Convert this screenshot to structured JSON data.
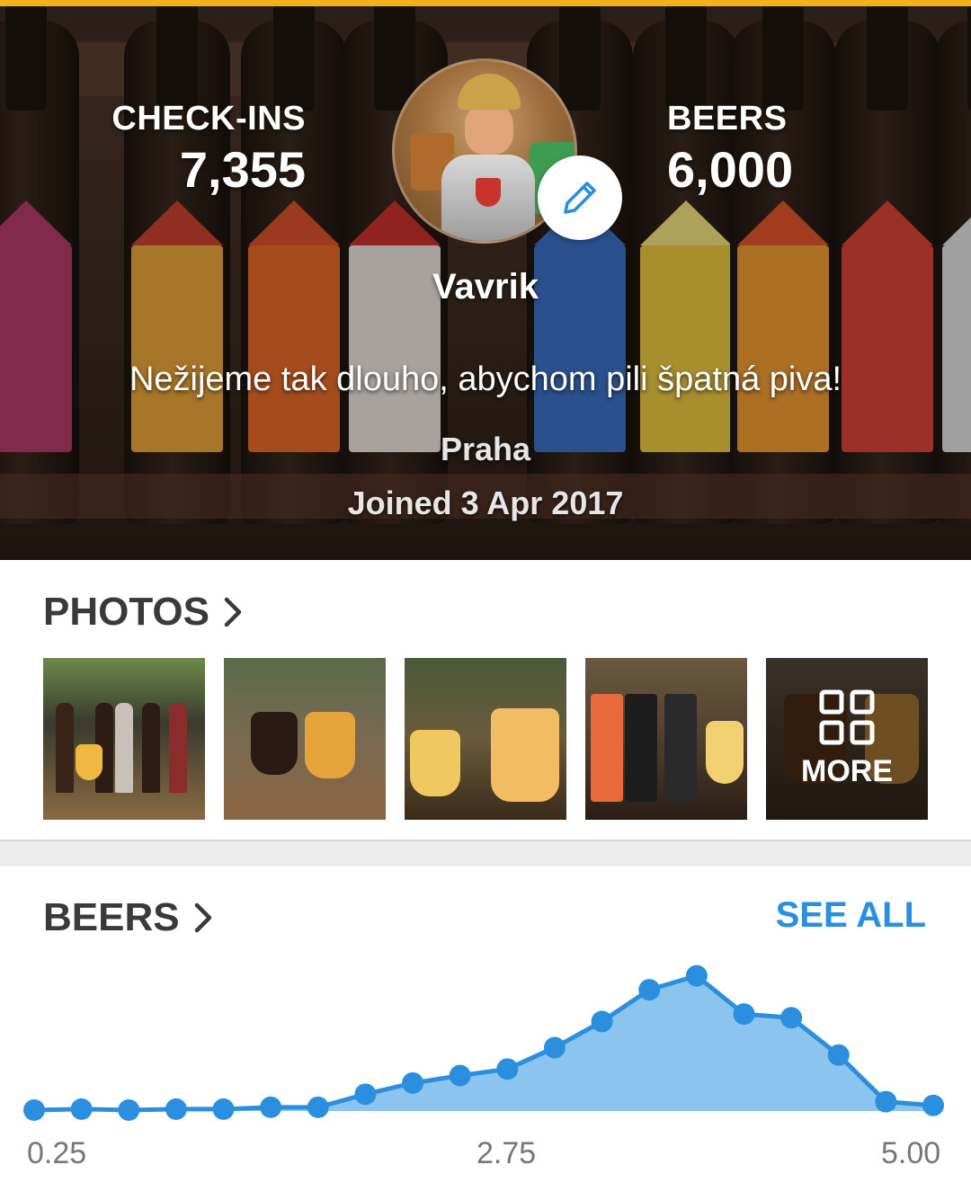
{
  "profile": {
    "checkins_label": "CHECK-INS",
    "checkins_value": "7,355",
    "beers_label": "BEERS",
    "beers_value": "6,000",
    "username": "Vavrik",
    "bio": "Nežijeme tak dlouho, abychom pili špatná piva!",
    "location": "Praha",
    "joined": "Joined 3 Apr 2017",
    "edit_icon": "pencil-icon"
  },
  "photos": {
    "title": "PHOTOS",
    "more_label": "MORE",
    "more_icon": "grid-icon"
  },
  "beers_section": {
    "title": "BEERS",
    "see_all": "SEE ALL"
  },
  "colors": {
    "accent": "#2b8fe0",
    "top_strip": "#f2b01e",
    "area_fill": "#8cc4f0"
  },
  "chart_data": {
    "type": "area",
    "x": [
      0.25,
      0.5,
      0.75,
      1.0,
      1.25,
      1.5,
      1.75,
      2.0,
      2.25,
      2.5,
      2.75,
      3.0,
      3.25,
      3.5,
      3.75,
      4.0,
      4.25,
      4.5,
      4.75,
      5.0
    ],
    "values": [
      1,
      2,
      1,
      2,
      2,
      4,
      4,
      18,
      30,
      38,
      45,
      68,
      96,
      130,
      145,
      104,
      100,
      60,
      10,
      6
    ],
    "tick_labels": [
      "0.25",
      "2.75",
      "5.00"
    ],
    "xlim": [
      0.25,
      5.0
    ],
    "ylim": [
      0,
      160
    ],
    "grid": false,
    "legend": "none"
  }
}
